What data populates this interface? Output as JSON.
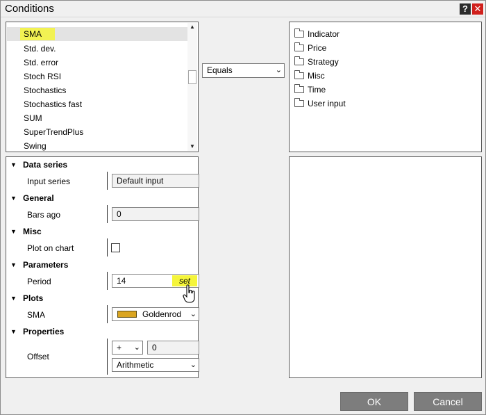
{
  "window": {
    "title": "Conditions",
    "help": "?",
    "close": "✕"
  },
  "function_list": {
    "items": [
      "SMA",
      "Std. dev.",
      "Std. error",
      "Stoch RSI",
      "Stochastics",
      "Stochastics fast",
      "SUM",
      "SuperTrendPlus",
      "Swing"
    ],
    "selected": "SMA"
  },
  "operator": {
    "value": "Equals"
  },
  "tree": {
    "items": [
      "Indicator",
      "Price",
      "Strategy",
      "Misc",
      "Time",
      "User input"
    ]
  },
  "properties": {
    "data_series": {
      "label": "Data series",
      "input_series_label": "Input series",
      "input_series_value": "Default input"
    },
    "general": {
      "label": "General",
      "bars_ago_label": "Bars ago",
      "bars_ago_value": "0"
    },
    "misc": {
      "label": "Misc",
      "plot_on_chart_label": "Plot on chart",
      "plot_on_chart_checked": false
    },
    "parameters": {
      "label": "Parameters",
      "period_label": "Period",
      "period_value": "14",
      "set_label": "set"
    },
    "plots": {
      "label": "Plots",
      "sma_label": "SMA",
      "sma_color_name": "Goldenrod",
      "sma_color": "#daa520"
    },
    "props": {
      "label": "Properties",
      "offset_label": "Offset",
      "offset_sign": "+",
      "offset_value": "0",
      "offset_type": "Arithmetic"
    }
  },
  "buttons": {
    "ok": "OK",
    "cancel": "Cancel"
  },
  "colors": {
    "highlight": "#f5f53a",
    "button_bg": "#7d7d7d",
    "close_bg": "#d0201c"
  }
}
